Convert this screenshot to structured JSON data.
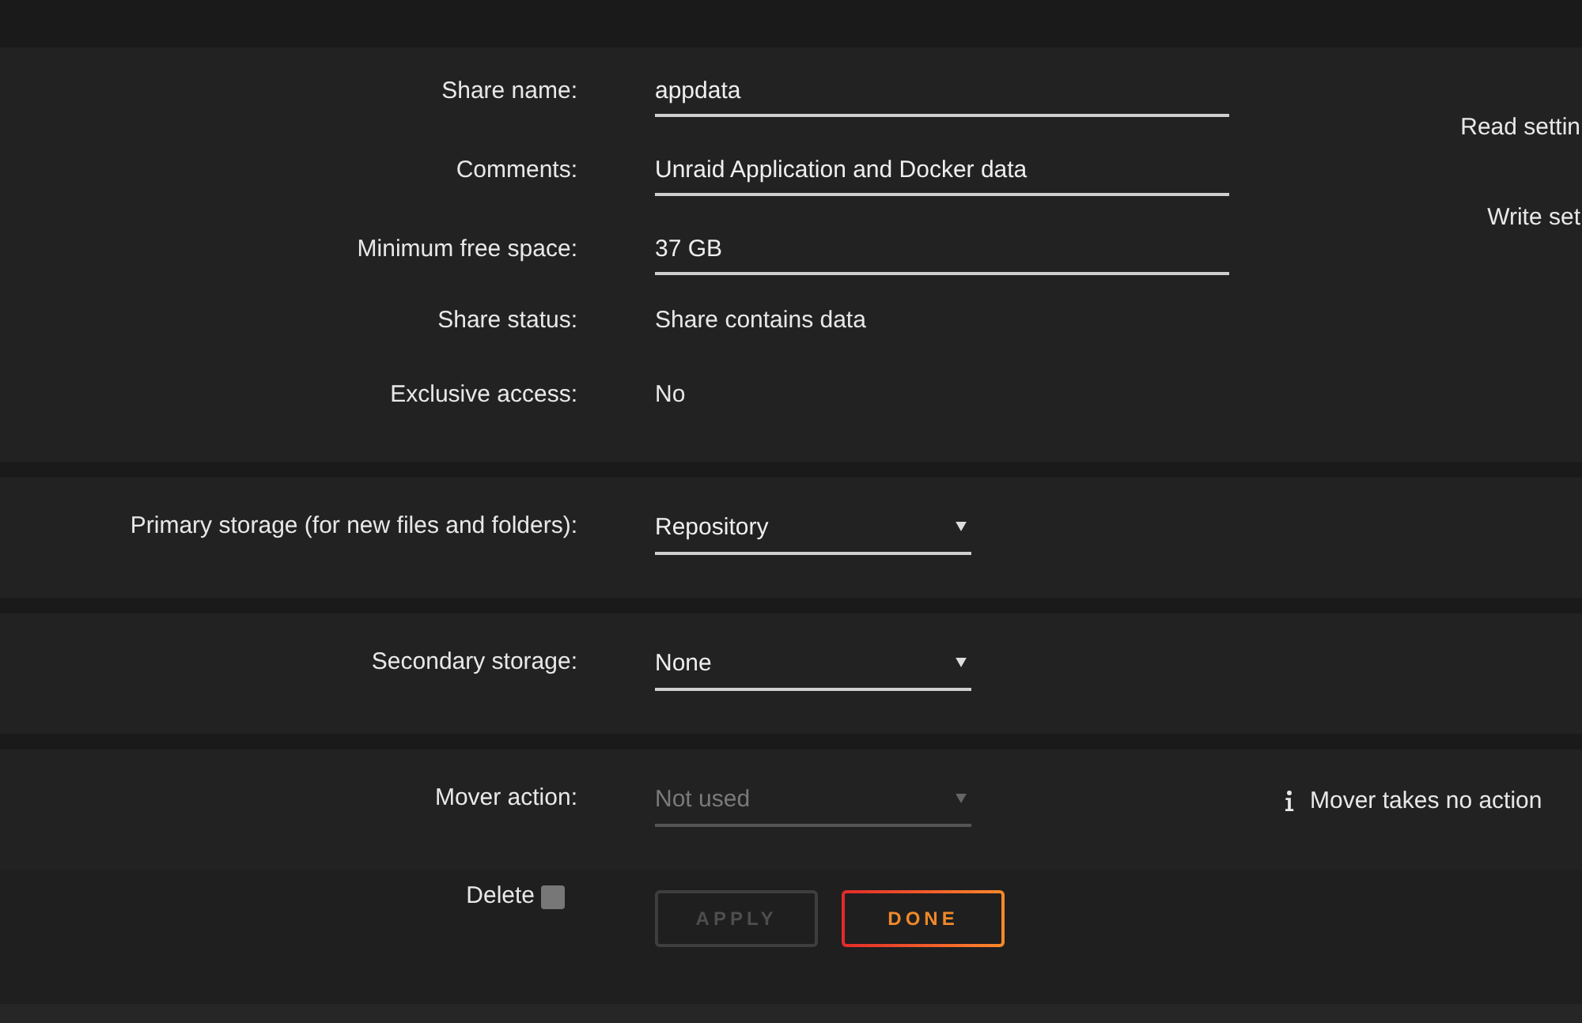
{
  "share_settings": {
    "fields": [
      {
        "kind": "input",
        "label": "Share name:",
        "value": "appdata"
      },
      {
        "kind": "input",
        "label": "Comments:",
        "value": "Unraid Application and Docker data"
      },
      {
        "kind": "input",
        "label": "Minimum free space:",
        "value": "37 GB"
      },
      {
        "kind": "text",
        "label": "Share status:",
        "value": "Share contains data"
      },
      {
        "kind": "text",
        "label": "Exclusive access:",
        "value": "No"
      }
    ],
    "side_labels": [
      "Read settin",
      "Write set"
    ]
  },
  "storage_sections": [
    {
      "label": "Primary storage (for new files and folders):",
      "value": "Repository",
      "disabled": false
    },
    {
      "label": "Secondary storage:",
      "value": "None",
      "disabled": false
    },
    {
      "label": "Mover action:",
      "value": "Not used",
      "disabled": true,
      "info": "Mover takes no action"
    }
  ],
  "actions": {
    "delete": {
      "label": "Delete",
      "checked": false
    },
    "buttons": [
      {
        "label": "APPLY",
        "disabled": true
      },
      {
        "label": "DONE",
        "disabled": false
      }
    ]
  }
}
